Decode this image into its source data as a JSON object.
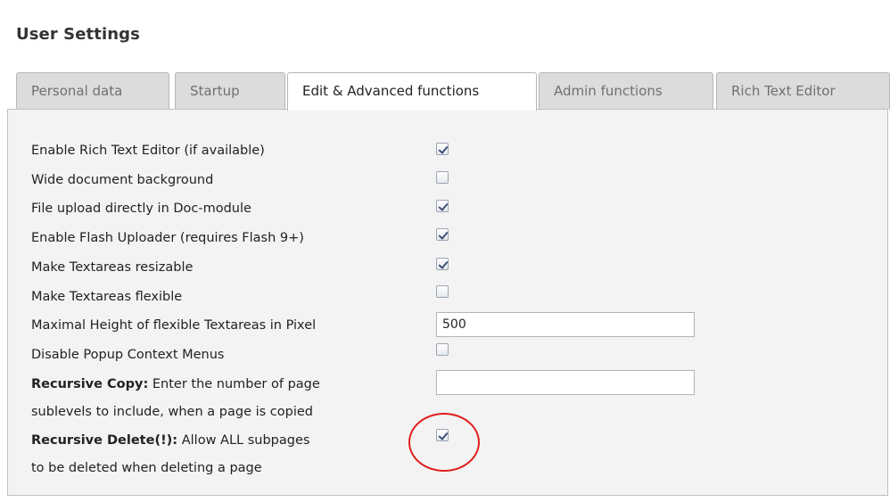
{
  "page": {
    "title": "User Settings"
  },
  "tabs": [
    {
      "label": "Personal data",
      "active": false
    },
    {
      "label": "Startup",
      "active": false
    },
    {
      "label": "Edit & Advanced functions",
      "active": true
    },
    {
      "label": "Admin functions",
      "active": false
    },
    {
      "label": "Rich Text Editor",
      "active": false
    }
  ],
  "settings": {
    "enable_rte": {
      "label": "Enable Rich Text Editor (if available)",
      "checked": true
    },
    "wide_background": {
      "label": "Wide document background",
      "checked": false
    },
    "file_upload_doc": {
      "label": "File upload directly in Doc-module",
      "checked": true
    },
    "flash_uploader": {
      "label": "Enable Flash Uploader (requires Flash 9+)",
      "checked": true
    },
    "textareas_resizable": {
      "label": "Make Textareas resizable",
      "checked": true
    },
    "textareas_flexible": {
      "label": "Make Textareas flexible",
      "checked": false
    },
    "max_height": {
      "label": "Maximal Height of flexible Textareas in Pixel",
      "value": "500"
    },
    "disable_popup": {
      "label": "Disable Popup Context Menus",
      "checked": false
    },
    "recursive_copy": {
      "label_bold": "Recursive Copy:",
      "label_rest_line1": " Enter the number of page",
      "label_line2": "sublevels to include, when a page is copied",
      "value": ""
    },
    "recursive_delete": {
      "label_bold": "Recursive Delete(!):",
      "label_rest_line1": " Allow ALL subpages",
      "label_line2": "to be deleted when deleting a page",
      "checked": true,
      "highlighted": true
    }
  },
  "colors": {
    "highlight_ring": "#e02020",
    "panel_bg": "#f3f3f3",
    "tab_inactive_bg": "#dcdcdc"
  }
}
